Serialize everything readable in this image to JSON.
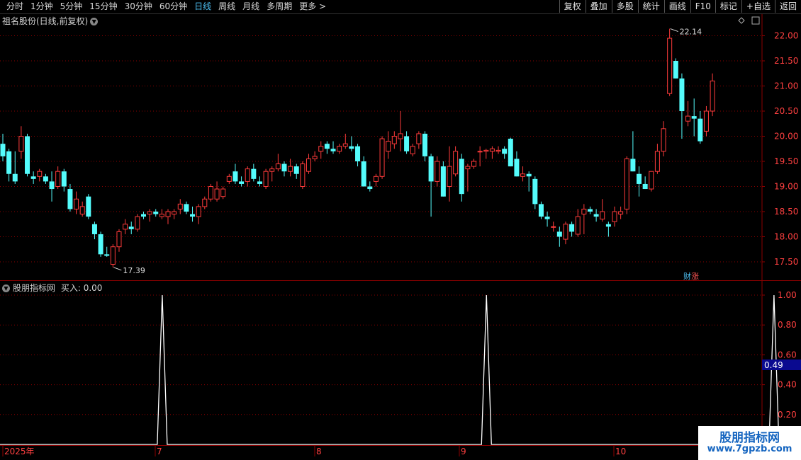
{
  "toolbar": {
    "periods": [
      "分时",
      "1分钟",
      "5分钟",
      "15分钟",
      "30分钟",
      "60分钟",
      "日线",
      "周线",
      "月线",
      "多周期",
      "更多 >"
    ],
    "active_period": "日线",
    "actions": [
      "复权",
      "叠加",
      "多股",
      "统计",
      "画线",
      "F10",
      "标记",
      "+自选",
      "返回"
    ]
  },
  "main_panel": {
    "title": "祖名股份(日线,前复权)",
    "high_label": "22.14",
    "low_label": "17.39",
    "price_ticks": [
      "22.00",
      "21.50",
      "21.00",
      "20.50",
      "20.00",
      "19.50",
      "19.00",
      "18.50",
      "18.00",
      "17.50"
    ],
    "tag_a": "财",
    "tag_b": "涨"
  },
  "indicator_panel": {
    "title": "股朋指标网",
    "value_label": "买入: 0.00",
    "ticks": [
      "1.00",
      "0.80",
      "0.60",
      "0.40",
      "0.20"
    ],
    "cursor_value": "0.49"
  },
  "time_axis": {
    "labels": [
      "2025年",
      "7",
      "8",
      "9",
      "10"
    ]
  },
  "watermark": {
    "line1": "股朋指标网",
    "line2": "www.7gpzb.com"
  },
  "colors": {
    "up": "#ff3b3b",
    "down": "#54fcfc",
    "grid": "#8b0000",
    "signal": "#ffffff"
  },
  "chart_data": [
    {
      "type": "candlestick",
      "title": "祖名股份(日线,前复权)",
      "ylim": [
        17.3,
        22.3
      ],
      "y_ticks": [
        17.5,
        18.0,
        18.5,
        19.0,
        19.5,
        20.0,
        20.5,
        21.0,
        21.5,
        22.0
      ],
      "annotations": [
        {
          "text": "22.14",
          "value": 22.14
        },
        {
          "text": "17.39",
          "value": 17.39
        }
      ],
      "ohlc": [
        [
          19.85,
          20.05,
          19.5,
          19.6
        ],
        [
          19.7,
          19.75,
          19.1,
          19.25
        ],
        [
          19.25,
          19.7,
          19.05,
          19.1
        ],
        [
          19.7,
          20.2,
          19.55,
          20.0
        ],
        [
          20.0,
          20.05,
          19.2,
          19.25
        ],
        [
          19.2,
          19.3,
          19.05,
          19.15
        ],
        [
          19.2,
          19.35,
          19.1,
          19.3
        ],
        [
          19.2,
          19.25,
          19.05,
          19.1
        ],
        [
          19.1,
          19.3,
          18.7,
          18.95
        ],
        [
          19.0,
          19.4,
          18.95,
          19.3
        ],
        [
          19.3,
          19.35,
          18.9,
          19.0
        ],
        [
          18.95,
          19.05,
          18.5,
          18.55
        ],
        [
          18.55,
          18.9,
          18.45,
          18.75
        ],
        [
          18.45,
          18.7,
          18.4,
          18.6
        ],
        [
          18.8,
          18.85,
          18.35,
          18.4
        ],
        [
          18.25,
          18.3,
          17.95,
          18.05
        ],
        [
          18.05,
          18.1,
          17.6,
          17.65
        ],
        [
          17.65,
          17.8,
          17.6,
          17.62
        ],
        [
          17.45,
          17.85,
          17.39,
          17.8
        ],
        [
          17.8,
          18.15,
          17.7,
          18.1
        ],
        [
          18.15,
          18.35,
          18.05,
          18.25
        ],
        [
          18.2,
          18.3,
          18.05,
          18.15
        ],
        [
          18.15,
          18.45,
          18.1,
          18.4
        ],
        [
          18.45,
          18.5,
          18.35,
          18.4
        ],
        [
          18.45,
          18.55,
          18.3,
          18.5
        ],
        [
          18.5,
          18.55,
          18.4,
          18.45
        ],
        [
          18.4,
          18.55,
          18.35,
          18.45
        ],
        [
          18.4,
          18.55,
          18.25,
          18.5
        ],
        [
          18.45,
          18.55,
          18.35,
          18.5
        ],
        [
          18.55,
          18.75,
          18.45,
          18.65
        ],
        [
          18.65,
          18.7,
          18.45,
          18.5
        ],
        [
          18.45,
          18.6,
          18.3,
          18.4
        ],
        [
          18.4,
          18.65,
          18.25,
          18.6
        ],
        [
          18.6,
          18.8,
          18.55,
          18.75
        ],
        [
          18.75,
          19.05,
          18.7,
          19.0
        ],
        [
          18.75,
          19.1,
          18.7,
          18.95
        ],
        [
          18.8,
          19.0,
          18.75,
          18.95
        ],
        [
          19.1,
          19.25,
          19.05,
          19.2
        ],
        [
          19.3,
          19.45,
          19.05,
          19.1
        ],
        [
          19.1,
          19.2,
          19.0,
          19.05
        ],
        [
          19.1,
          19.4,
          19.0,
          19.35
        ],
        [
          19.35,
          19.45,
          19.1,
          19.15
        ],
        [
          19.1,
          19.2,
          19.0,
          19.05
        ],
        [
          19.0,
          19.35,
          18.95,
          19.3
        ],
        [
          19.3,
          19.4,
          19.1,
          19.35
        ],
        [
          19.35,
          19.65,
          19.3,
          19.45
        ],
        [
          19.45,
          19.5,
          19.2,
          19.3
        ],
        [
          19.3,
          19.55,
          19.2,
          19.4
        ],
        [
          19.4,
          19.45,
          19.15,
          19.25
        ],
        [
          19.0,
          19.5,
          18.95,
          19.45
        ],
        [
          19.3,
          19.65,
          19.25,
          19.55
        ],
        [
          19.55,
          19.7,
          19.5,
          19.6
        ],
        [
          19.7,
          19.9,
          19.55,
          19.8
        ],
        [
          19.85,
          19.9,
          19.65,
          19.75
        ],
        [
          19.75,
          19.9,
          19.65,
          19.7
        ],
        [
          19.7,
          19.85,
          19.65,
          19.8
        ],
        [
          19.8,
          20.05,
          19.75,
          19.85
        ],
        [
          19.8,
          20.0,
          19.7,
          19.75
        ],
        [
          19.8,
          19.85,
          19.4,
          19.5
        ],
        [
          19.5,
          19.6,
          19.0,
          19.0
        ],
        [
          19.0,
          19.1,
          18.9,
          18.95
        ],
        [
          19.1,
          19.25,
          19.0,
          19.2
        ],
        [
          19.2,
          20.0,
          19.15,
          19.95
        ],
        [
          19.7,
          20.1,
          19.55,
          19.9
        ],
        [
          19.85,
          20.1,
          19.75,
          20.0
        ],
        [
          19.95,
          20.5,
          19.7,
          20.05
        ],
        [
          20.0,
          20.1,
          19.65,
          19.7
        ],
        [
          19.65,
          19.85,
          19.6,
          19.8
        ],
        [
          19.85,
          20.1,
          19.75,
          20.05
        ],
        [
          20.05,
          20.1,
          19.5,
          19.6
        ],
        [
          19.6,
          19.65,
          18.4,
          19.1
        ],
        [
          19.1,
          19.6,
          19.0,
          19.5
        ],
        [
          19.4,
          19.5,
          18.8,
          18.8
        ],
        [
          19.0,
          19.8,
          18.7,
          19.4
        ],
        [
          19.25,
          19.8,
          19.2,
          19.7
        ],
        [
          19.55,
          19.65,
          18.7,
          18.85
        ],
        [
          19.35,
          19.45,
          18.9,
          19.4
        ],
        [
          19.4,
          19.55,
          19.35,
          19.5
        ],
        [
          19.7,
          19.8,
          19.4,
          19.7
        ],
        [
          19.7,
          19.75,
          19.55,
          19.72
        ],
        [
          19.7,
          19.8,
          19.55,
          19.75
        ],
        [
          19.7,
          19.8,
          19.65,
          19.72
        ],
        [
          19.75,
          19.8,
          19.55,
          19.65
        ],
        [
          19.95,
          19.97,
          19.4,
          19.4
        ],
        [
          19.55,
          19.7,
          19.2,
          19.2
        ],
        [
          19.2,
          19.4,
          19.1,
          19.25
        ],
        [
          19.25,
          19.3,
          18.9,
          19.2
        ],
        [
          19.15,
          19.2,
          18.55,
          18.65
        ],
        [
          18.65,
          18.7,
          18.35,
          18.4
        ],
        [
          18.4,
          18.5,
          18.2,
          18.35
        ],
        [
          18.2,
          18.3,
          18.1,
          18.2
        ],
        [
          18.1,
          18.2,
          17.8,
          18.0
        ],
        [
          17.95,
          18.3,
          17.85,
          18.25
        ],
        [
          18.25,
          18.3,
          18.0,
          18.1
        ],
        [
          18.05,
          18.55,
          18.0,
          18.4
        ],
        [
          18.45,
          18.65,
          18.05,
          18.55
        ],
        [
          18.55,
          18.6,
          18.45,
          18.5
        ],
        [
          18.45,
          18.55,
          18.3,
          18.4
        ],
        [
          18.35,
          18.75,
          18.3,
          18.5
        ],
        [
          18.25,
          18.3,
          18.0,
          18.2
        ],
        [
          18.3,
          18.6,
          18.2,
          18.5
        ],
        [
          18.45,
          18.6,
          18.35,
          18.5
        ],
        [
          18.55,
          19.6,
          18.45,
          19.55
        ],
        [
          19.55,
          20.1,
          19.3,
          19.3
        ],
        [
          19.25,
          19.4,
          18.8,
          19.05
        ],
        [
          19.05,
          19.2,
          18.95,
          18.95
        ],
        [
          18.95,
          19.3,
          18.9,
          19.3
        ],
        [
          19.3,
          19.85,
          19.25,
          19.7
        ],
        [
          19.7,
          20.3,
          19.6,
          20.15
        ],
        [
          20.85,
          22.14,
          20.8,
          21.95
        ],
        [
          21.5,
          21.55,
          21.15,
          21.15
        ],
        [
          21.15,
          21.25,
          19.95,
          20.5
        ],
        [
          20.3,
          20.7,
          20.2,
          20.4
        ],
        [
          20.4,
          20.75,
          20.0,
          20.35
        ],
        [
          20.35,
          20.5,
          19.85,
          19.9
        ],
        [
          20.1,
          20.6,
          20.0,
          20.5
        ],
        [
          20.5,
          21.25,
          20.4,
          21.1
        ]
      ]
    },
    {
      "type": "line",
      "title": "股朋指标网",
      "ylim": [
        0,
        1.1
      ],
      "y_ticks": [
        0.2,
        0.4,
        0.6,
        0.8,
        1.0
      ],
      "series": [
        {
          "name": "买入",
          "spikes_at_index": [
            26,
            79,
            126
          ],
          "values_note_free": true
        }
      ]
    }
  ]
}
